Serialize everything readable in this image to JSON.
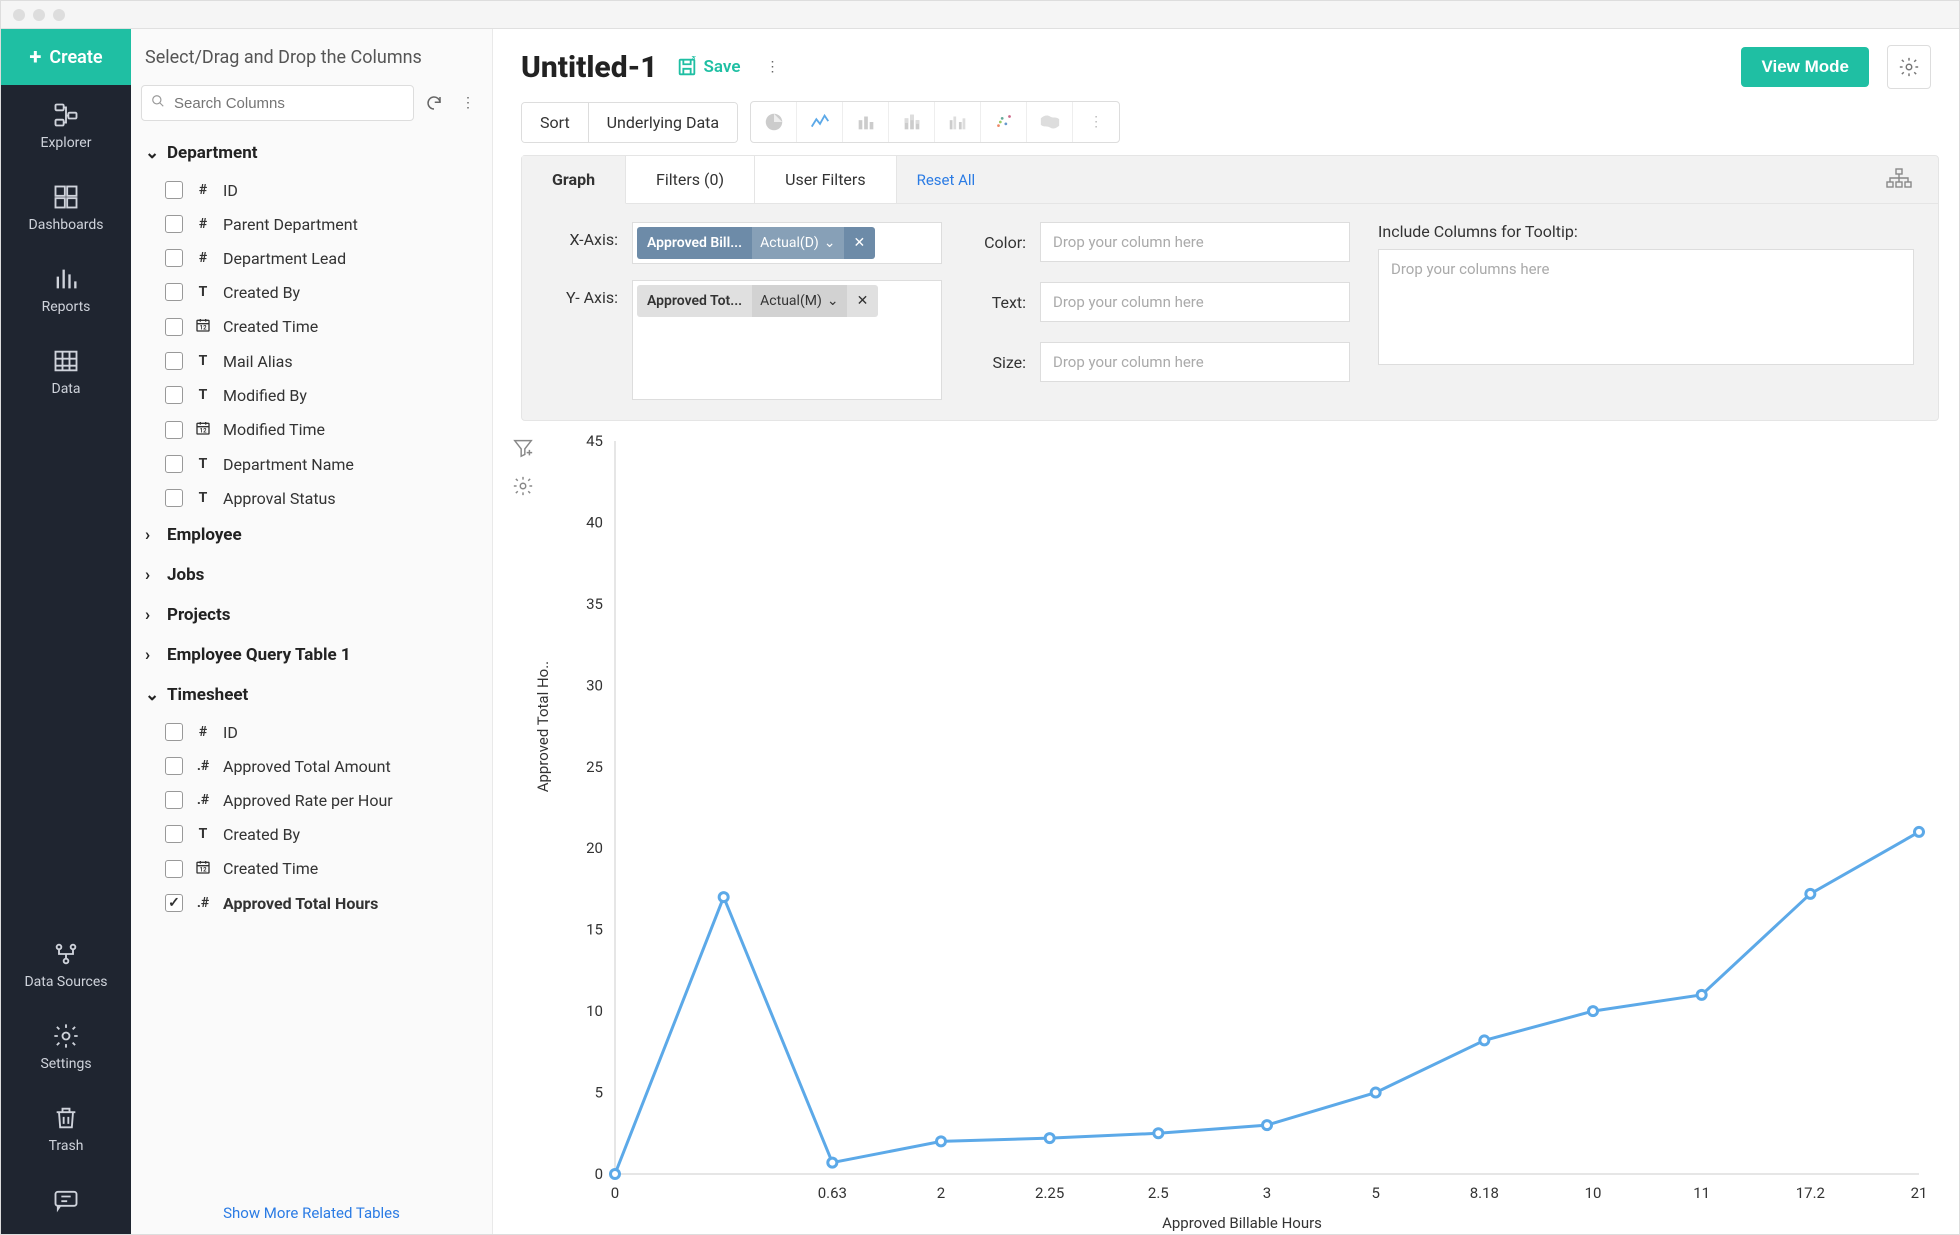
{
  "create_label": "Create",
  "rail": [
    {
      "key": "explorer",
      "label": "Explorer"
    },
    {
      "key": "dashboards",
      "label": "Dashboards"
    },
    {
      "key": "reports",
      "label": "Reports"
    },
    {
      "key": "data",
      "label": "Data"
    }
  ],
  "rail_bottom": [
    {
      "key": "data-sources",
      "label": "Data Sources"
    },
    {
      "key": "settings",
      "label": "Settings"
    },
    {
      "key": "trash",
      "label": "Trash"
    }
  ],
  "cols_header": "Select/Drag and Drop the Columns",
  "search_placeholder": "Search Columns",
  "groups": [
    {
      "name": "Department",
      "expanded": true,
      "items": [
        {
          "type": "#",
          "label": "ID"
        },
        {
          "type": "#",
          "label": "Parent Department"
        },
        {
          "type": "#",
          "label": "Department Lead"
        },
        {
          "type": "T",
          "label": "Created By"
        },
        {
          "type": "cal",
          "label": "Created Time"
        },
        {
          "type": "T",
          "label": "Mail Alias"
        },
        {
          "type": "T",
          "label": "Modified By"
        },
        {
          "type": "cal",
          "label": "Modified Time"
        },
        {
          "type": "T",
          "label": "Department Name"
        },
        {
          "type": "T",
          "label": "Approval Status"
        }
      ]
    },
    {
      "name": "Employee",
      "expanded": false,
      "items": []
    },
    {
      "name": "Jobs",
      "expanded": false,
      "items": []
    },
    {
      "name": "Projects",
      "expanded": false,
      "items": []
    },
    {
      "name": "Employee Query Table 1",
      "expanded": false,
      "items": []
    },
    {
      "name": "Timesheet",
      "expanded": true,
      "items": [
        {
          "type": "#",
          "label": "ID"
        },
        {
          "type": ".#",
          "label": "Approved Total Amount"
        },
        {
          "type": ".#",
          "label": "Approved Rate per Hour"
        },
        {
          "type": "T",
          "label": "Created By"
        },
        {
          "type": "cal",
          "label": "Created Time"
        },
        {
          "type": ".#",
          "label": "Approved Total Hours",
          "selected": true
        }
      ]
    }
  ],
  "show_more": "Show More Related Tables",
  "report_title": "Untitled-1",
  "save_label": "Save",
  "view_mode_label": "View Mode",
  "toolbar": {
    "sort": "Sort",
    "underlying": "Underlying Data"
  },
  "cfg_tabs": {
    "graph": "Graph",
    "filters": "Filters  (0)",
    "user_filters": "User Filters",
    "reset": "Reset All"
  },
  "axes": {
    "x_label": "X-Axis:",
    "y_label": "Y- Axis:",
    "x_pill_name": "Approved Bill...",
    "x_pill_agg": "Actual(D)",
    "y_pill_name": "Approved Tot...",
    "y_pill_agg": "Actual(M)"
  },
  "drops": {
    "color": "Color:",
    "text": "Text:",
    "size": "Size:",
    "placeholder": "Drop your column here"
  },
  "tooltip": {
    "label": "Include Columns for Tooltip:",
    "placeholder": "Drop your columns here"
  },
  "chart_data": {
    "type": "line",
    "xlabel": "Approved Billable Hours",
    "ylabel": "Approved Total Ho..",
    "y_ticks": [
      0,
      5,
      10,
      15,
      20,
      25,
      30,
      35,
      40,
      45
    ],
    "categories": [
      "0",
      "0",
      "0.63",
      "2",
      "2.25",
      "2.5",
      "3",
      "5",
      "8.18",
      "10",
      "11",
      "17.2",
      "21"
    ],
    "x_tick_labels": [
      "0",
      "0.63",
      "2",
      "2.25",
      "2.5",
      "3",
      "5",
      "8.18",
      "10",
      "11",
      "17.2",
      "21"
    ],
    "values": [
      0,
      17,
      0.7,
      2,
      2.2,
      2.5,
      3,
      5,
      8.2,
      10,
      11,
      17.2,
      21
    ],
    "ylim": [
      0,
      45
    ],
    "color": "#5ca9e8"
  }
}
